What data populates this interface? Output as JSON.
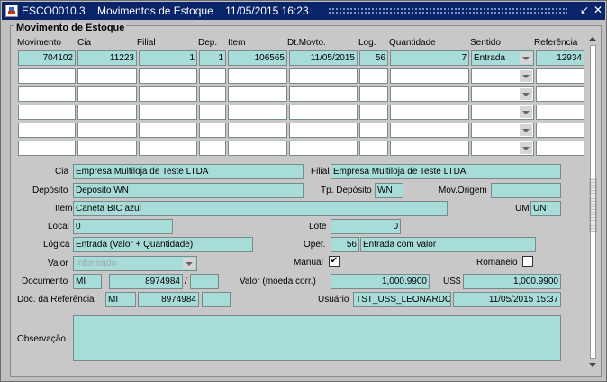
{
  "window": {
    "title": "ESCO0010.3    Movimentos de Estoque    11/05/2015 16:23"
  },
  "panel": {
    "caption": "Movimento de Estoque"
  },
  "grid": {
    "headers": [
      "Movimento",
      "Cia",
      "Filial",
      "Dep.",
      "Item",
      "Dt.Movto.",
      "Log.",
      "Quantidade",
      "Sentido",
      "Referência"
    ],
    "row1": [
      "704102",
      "11223",
      "1",
      "1",
      "106565",
      "11/05/2015",
      "56",
      "7",
      "Entrada",
      "12934"
    ]
  },
  "detail": {
    "cia_label": "Cia",
    "cia": "Empresa Multiloja de Teste LTDA",
    "filial_label": "Filial",
    "filial": "Empresa Multiloja de Teste LTDA",
    "deposito_label": "Depósito",
    "deposito": "Deposito WN",
    "tp_deposito_label": "Tp. Depósito",
    "tp_deposito": "WN",
    "mov_origem_label": "Mov.Origem",
    "mov_origem": "",
    "item_label": "Item",
    "item": "Caneta BIC azul",
    "um_label": "UM",
    "um": "UN",
    "local_label": "Local",
    "local": "0",
    "lote_label": "Lote",
    "lote": "0",
    "logica_label": "Lógica",
    "logica": "Entrada (Valor + Quantidade)",
    "oper_label": "Oper.",
    "oper_code": "56",
    "oper_desc": "Entrada com valor",
    "valor_label": "Valor",
    "valor": "Informado",
    "manual_label": "Manual",
    "manual_check": "✔",
    "romaneio_label": "Romaneio",
    "documento_label": "Documento",
    "doc_tipo": "MI",
    "doc_num": "8974984",
    "doc_sep": "/",
    "doc_serie": "",
    "valor_moeda_label": "Valor (moeda corr.)",
    "valor_moeda": "1,000.9900",
    "usd_label": "US$",
    "usd": "1,000.9900",
    "docref_label": "Doc. da Referência",
    "docref_tipo": "MI",
    "docref_num": "8974984",
    "docref_serie": "",
    "usuario_label": "Usuário",
    "usuario": "TST_USS_LEONARDC",
    "usuario_dt": "11/05/2015 15:37",
    "obs_label": "Observação",
    "obs": ""
  },
  "colors": {
    "field": "#a8dcd8",
    "titlebar": "#0a246a",
    "empty_field": "#ffffff"
  }
}
